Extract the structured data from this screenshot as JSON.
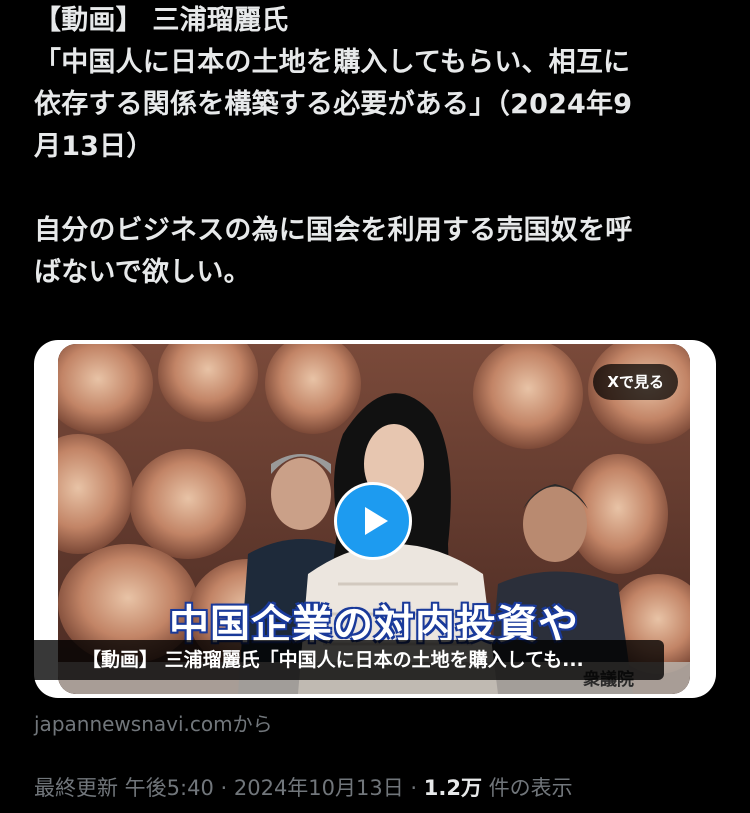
{
  "post": {
    "lines": [
      "【動画】 三浦瑠麗氏",
      "「中国人に日本の土地を購入してもらい、相互に",
      "依存する関係を構築する必要がある」（2024年9",
      "月13日）",
      "自分のビジネスの為に国会を利用する売国奴を呼",
      "ばないで欲しい。"
    ]
  },
  "card": {
    "view_on_x_label": "Xで見る",
    "video_subtitle": "中国企業の対内投資や",
    "watermark": "衆議院",
    "caption": "【動画】 三浦瑠麗氏「中国人に日本の土地を購入しても..."
  },
  "source": {
    "text": "japannewsnavi.comから"
  },
  "meta": {
    "prefix": "最終更新 午後5:40 · 2024年10月13日 · ",
    "views": "1.2万",
    "suffix": " 件の表示"
  },
  "colors": {
    "background": "#000000",
    "text": "#e7e9ea",
    "muted": "#71767b",
    "accent": "#1d9bf0"
  }
}
